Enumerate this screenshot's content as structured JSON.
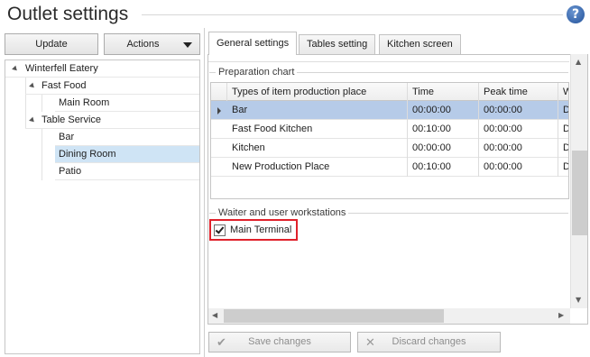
{
  "page": {
    "title": "Outlet settings",
    "help_icon": "?"
  },
  "left": {
    "update_label": "Update",
    "actions_label": "Actions"
  },
  "tree": {
    "root": "Winterfell Eatery",
    "fast_food": "Fast Food",
    "main_room": "Main Room",
    "table_service": "Table Service",
    "bar": "Bar",
    "dining_room": "Dining Room",
    "patio": "Patio",
    "selected": "Dining Room"
  },
  "tabs": [
    "General settings",
    "Tables setting",
    "Kitchen screen"
  ],
  "active_tab": "General settings",
  "prep_chart": {
    "title": "Preparation chart",
    "columns": [
      "Types of item production place",
      "Time",
      "Peak time",
      "W"
    ],
    "rows": [
      [
        "Bar",
        "00:00:00",
        "00:00:00",
        "De"
      ],
      [
        "Fast Food Kitchen",
        "00:10:00",
        "00:00:00",
        "De"
      ],
      [
        "Kitchen",
        "00:00:00",
        "00:00:00",
        "De"
      ],
      [
        "New Production Place",
        "00:10:00",
        "00:00:00",
        "De"
      ]
    ]
  },
  "workstations": {
    "title": "Waiter and user workstations",
    "items": [
      {
        "label": "Main Terminal",
        "checked": true
      }
    ]
  },
  "footer": {
    "save_label": "Save changes",
    "discard_label": "Discard changes"
  },
  "colors": {
    "selected_row": "#b6cbe8",
    "tree_selected": "#cfe4f5",
    "highlight_border": "#e0212b"
  }
}
